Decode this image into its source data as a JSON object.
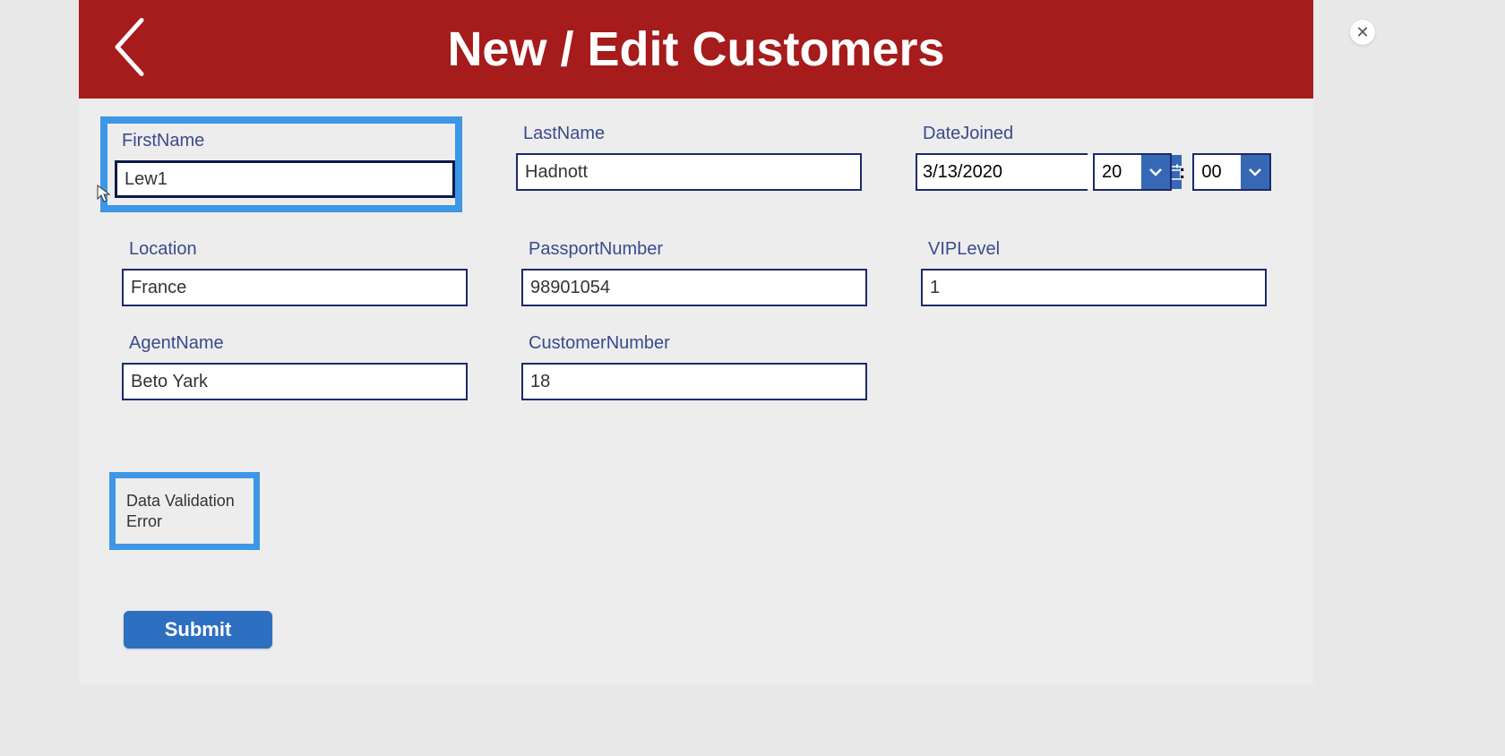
{
  "header": {
    "title": "New / Edit Customers"
  },
  "form": {
    "firstName": {
      "label": "FirstName",
      "value": "Lew1"
    },
    "lastName": {
      "label": "LastName",
      "value": "Hadnott"
    },
    "dateJoined": {
      "label": "DateJoined",
      "date": "3/13/2020",
      "hour": "20",
      "minute": "00"
    },
    "location": {
      "label": "Location",
      "value": "France"
    },
    "passportNumber": {
      "label": "PassportNumber",
      "value": "98901054"
    },
    "vipLevel": {
      "label": "VIPLevel",
      "value": "1"
    },
    "agentName": {
      "label": "AgentName",
      "value": "Beto Yark"
    },
    "customerNumber": {
      "label": "CustomerNumber",
      "value": "18"
    }
  },
  "error": {
    "message": "Data Validation Error"
  },
  "actions": {
    "submit": "Submit"
  },
  "timeSeparator": ":"
}
